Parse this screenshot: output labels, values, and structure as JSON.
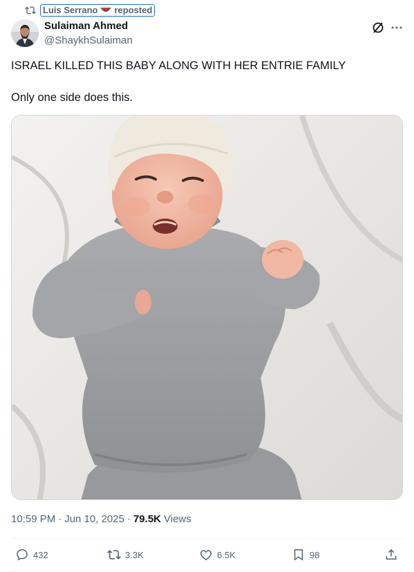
{
  "repost": {
    "user": "Luis Serrano",
    "label": "reposted"
  },
  "author": {
    "name": "Sulaiman Ahmed",
    "handle": "@ShaykhSulaiman"
  },
  "tweet": {
    "line1": "ISRAEL KILLED THIS BABY ALONG WITH HER ENTRIE FAMILY",
    "line2": "Only one side does this."
  },
  "meta": {
    "time": "10:59 PM",
    "sep1": "·",
    "date": "Jun 10, 2025",
    "sep2": "·",
    "views": "79.5K",
    "views_label": "Views"
  },
  "actions": {
    "replies": "432",
    "reposts": "3.3K",
    "likes": "6.5K",
    "bookmarks": "98"
  },
  "icons": [
    "repost-icon",
    "watermelon-icon",
    "grok-icon",
    "more-icon",
    "reply-icon",
    "retweet-icon",
    "like-icon",
    "bookmark-icon",
    "share-icon"
  ],
  "colors": {
    "text": "#0f1419",
    "secondary": "#536471",
    "highlight_box": "#1d6fd8",
    "divider": "#eff3f4"
  }
}
